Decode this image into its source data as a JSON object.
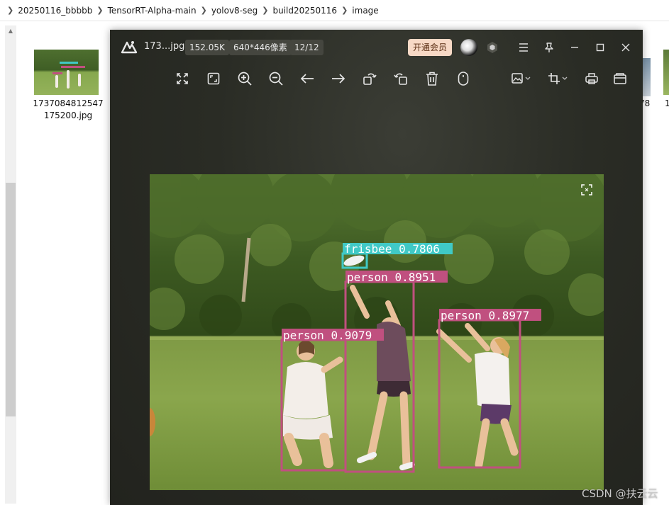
{
  "explorer": {
    "breadcrumb": [
      "20250116_bbbbb",
      "TensorRT-Alpha-main",
      "yolov8-seg",
      "build20250116",
      "image"
    ],
    "file": {
      "name": "1737084812547175200.jpg"
    },
    "right_labels": [
      "78",
      "1"
    ]
  },
  "viewer": {
    "title": "173...jpg",
    "file_size": "152.05K",
    "dimensions": "640*446像素",
    "index": "12/12",
    "vip_label": "开通会员",
    "toolbar_icons": [
      "fit-screen-icon",
      "actual-size-icon",
      "zoom-in-icon",
      "zoom-out-icon",
      "previous-icon",
      "next-icon",
      "rotate-left-icon",
      "rotate-right-icon",
      "delete-icon",
      "mouse-icon",
      "edit-image-icon",
      "crop-icon",
      "print-icon",
      "open-folder-icon"
    ],
    "window_icons": [
      "menu-icon",
      "pin-icon",
      "minimize-icon",
      "maximize-icon",
      "close-icon"
    ]
  },
  "detections": [
    {
      "label": "frisbee",
      "score": "0.7806",
      "color": "#40c9c6"
    },
    {
      "label": "person",
      "score": "0.8951",
      "color": "#c0507f"
    },
    {
      "label": "person",
      "score": "0.8977",
      "color": "#c0507f"
    },
    {
      "label": "person",
      "score": "0.9079",
      "color": "#c0507f"
    }
  ],
  "watermark": "CSDN @扶云云"
}
